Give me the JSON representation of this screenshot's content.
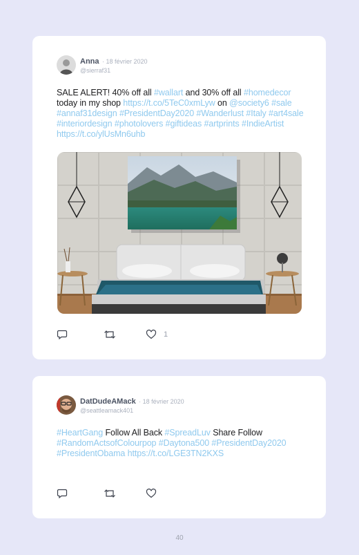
{
  "tweets": [
    {
      "name": "Anna",
      "date": "18 février 2020",
      "handle": "@sierraf31",
      "text_parts": [
        {
          "t": "SALE ALERT! 40% off all "
        },
        {
          "t": "#wallart",
          "link": true
        },
        {
          "t": " and 30% off all "
        },
        {
          "t": "#homedecor",
          "link": true
        },
        {
          "t": " today in my shop "
        },
        {
          "t": "https://t.co/5TeC0xmLyw",
          "link": true
        },
        {
          "t": " on "
        },
        {
          "t": "@society6 #sale #annaf31design #PresidentDay2020 #Wanderlust #Italy #art4sale #interiordesign #photolovers #giftideas #artprints #IndieArtist https://t.co/ylUsMn6uhb",
          "link": true
        }
      ],
      "like_count": "1"
    },
    {
      "name": "DatDudeAMack",
      "date": "18 février 2020",
      "handle": "@seattleamack401",
      "text_parts": [
        {
          "t": "#HeartGang",
          "link": true
        },
        {
          "t": " Follow All Back "
        },
        {
          "t": "#SpreadLuv",
          "link": true
        },
        {
          "t": " Share Follow "
        },
        {
          "t": "#RandomActsofColourpop #Daytona500 #PresidentDay2020 #PresidentObama https://t.co/LGE3TN2KXS",
          "link": true
        }
      ],
      "like_count": ""
    }
  ],
  "page_number": "40",
  "colors": {
    "page_background": "#e6e7f8",
    "card": "#ffffff",
    "link": "#8fc9ee",
    "muted": "#aab0bd"
  },
  "icons": [
    "reply-icon",
    "retweet-icon",
    "heart-icon"
  ]
}
